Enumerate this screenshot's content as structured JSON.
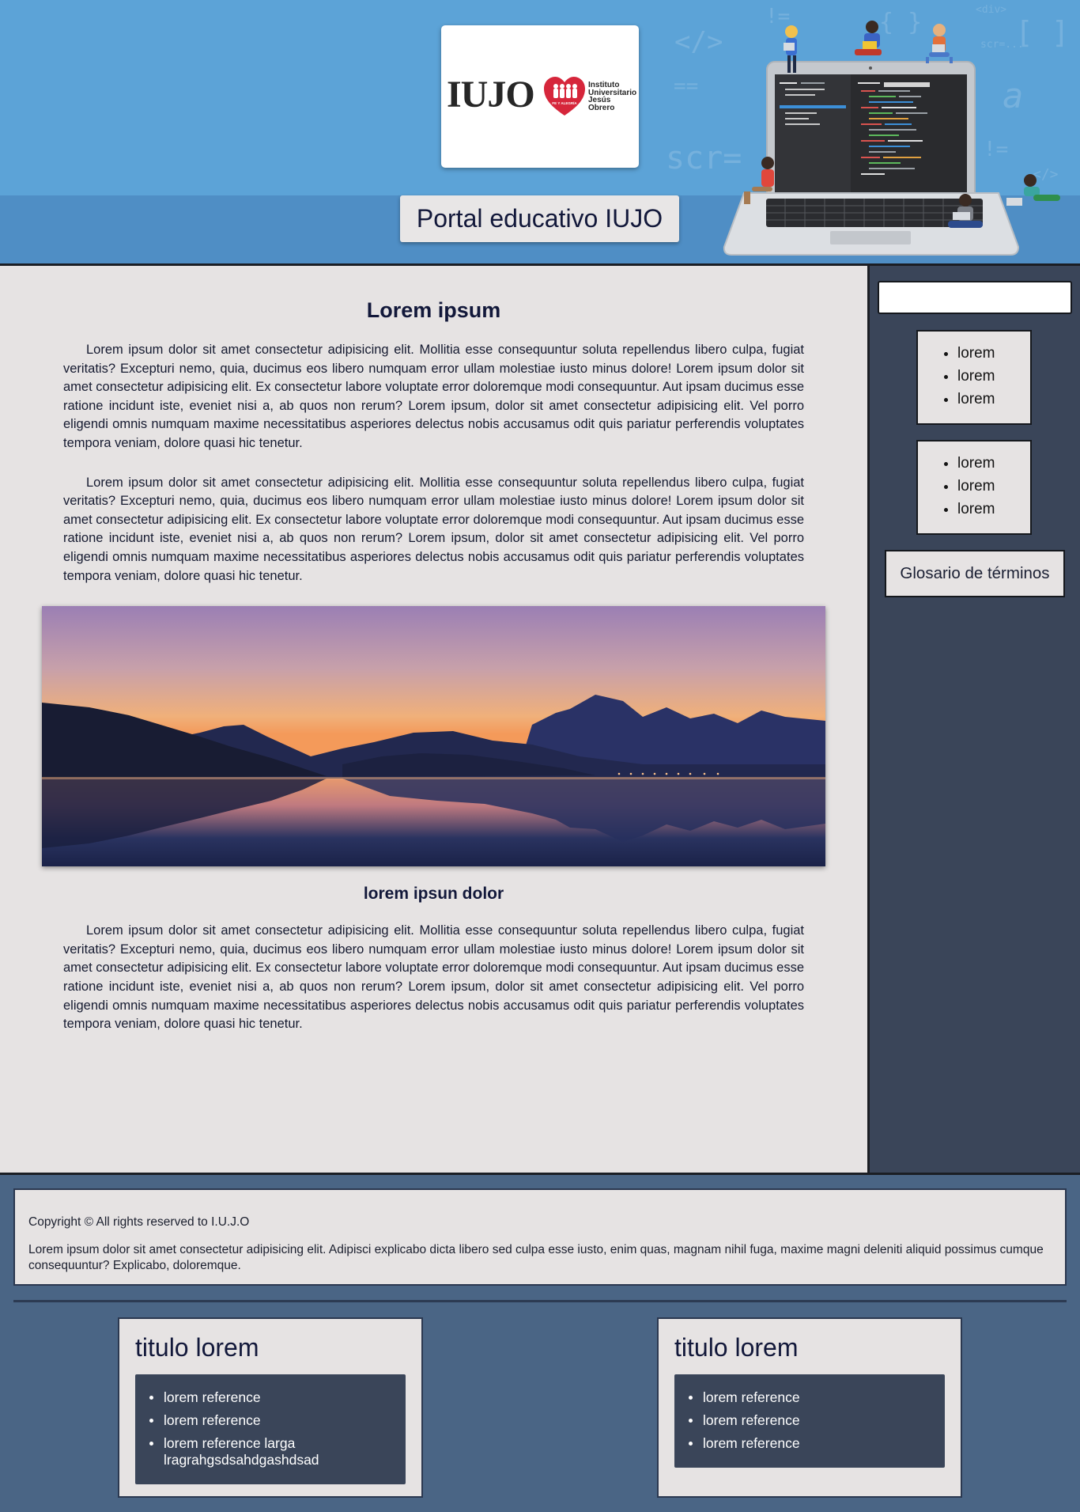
{
  "colors": {
    "header_top": "#5ca3d7",
    "header_band": "#4f8ec5",
    "content_bg": "#e6e3e3",
    "sidebar_bg": "#3a4559",
    "footer_bg": "#4a6585",
    "logo_heart": "#d6263b"
  },
  "header": {
    "logo": {
      "wordmark": "IUJO",
      "line1": "Instituto",
      "line2": "Universitario",
      "line3": "Jesús",
      "line4": "Obrero",
      "heart_text": "FE Y ALEGRÍA"
    },
    "title": "Portal educativo IUJO",
    "decor": [
      "</>",
      "{ }",
      "<div>",
      "!=",
      "scr=",
      "==",
      "[ ]",
      "a",
      "!=",
      "</>",
      "scr=..."
    ]
  },
  "main": {
    "heading": "Lorem ipsum",
    "paragraphs": [
      "Lorem ipsum dolor sit amet consectetur adipisicing elit. Mollitia esse consequuntur soluta repellendus libero culpa, fugiat veritatis? Excepturi nemo, quia, ducimus eos libero numquam error ullam molestiae iusto minus dolore! Lorem ipsum dolor sit amet consectetur adipisicing elit. Ex consectetur labore voluptate error doloremque modi consequuntur. Aut ipsam ducimus esse ratione incidunt iste, eveniet nisi a, ab quos non rerum? Lorem ipsum, dolor sit amet consectetur adipisicing elit. Vel porro eligendi omnis numquam maxime necessitatibus asperiores delectus nobis accusamus odit quis pariatur perferendis voluptates tempora veniam, dolore quasi hic tenetur.",
      "Lorem ipsum dolor sit amet consectetur adipisicing elit. Mollitia esse consequuntur soluta repellendus libero culpa, fugiat veritatis? Excepturi nemo, quia, ducimus eos libero numquam error ullam molestiae iusto minus dolore! Lorem ipsum dolor sit amet consectetur adipisicing elit. Ex consectetur labore voluptate error doloremque modi consequuntur. Aut ipsam ducimus esse ratione incidunt iste, eveniet nisi a, ab quos non rerum? Lorem ipsum, dolor sit amet consectetur adipisicing elit. Vel porro eligendi omnis numquam maxime necessitatibus asperiores delectus nobis accusamus odit quis pariatur perferendis voluptates tempora veniam, dolore quasi hic tenetur."
    ],
    "caption": "lorem ipsun dolor",
    "closing_paragraph": "Lorem ipsum dolor sit amet consectetur adipisicing elit. Mollitia esse consequuntur soluta repellendus libero culpa, fugiat veritatis? Excepturi nemo, quia, ducimus eos libero numquam error ullam molestiae iusto minus dolore! Lorem ipsum dolor sit amet consectetur adipisicing elit. Ex consectetur labore voluptate error doloremque modi consequuntur. Aut ipsam ducimus esse ratione incidunt iste, eveniet nisi a, ab quos non rerum? Lorem ipsum, dolor sit amet consectetur adipisicing elit. Vel porro eligendi omnis numquam maxime necessitatibus asperiores delectus nobis accusamus odit quis pariatur perferendis voluptates tempora veniam, dolore quasi hic tenetur."
  },
  "sidebar": {
    "search": {
      "value": "",
      "placeholder": ""
    },
    "lists": [
      [
        "lorem",
        "lorem",
        "lorem"
      ],
      [
        "lorem",
        "lorem",
        "lorem"
      ]
    ],
    "glossary_label": "Glosario de términos"
  },
  "footer": {
    "copyright": "Copyright © All rights reserved to I.U.J.O",
    "text": "Lorem ipsum dolor sit amet consectetur adipisicing elit. Adipisci explicabo dicta libero sed culpa esse iusto, enim quas, magnam nihil fuga, maxime magni deleniti aliquid possimus cumque consequuntur? Explicabo, doloremque.",
    "cards": [
      {
        "title": "titulo lorem",
        "items": [
          "lorem reference",
          "lorem reference",
          "lorem reference larga lragrahgsdsahdgashdsad"
        ]
      },
      {
        "title": "titulo lorem",
        "items": [
          "lorem reference",
          "lorem reference",
          "lorem reference"
        ]
      }
    ]
  }
}
